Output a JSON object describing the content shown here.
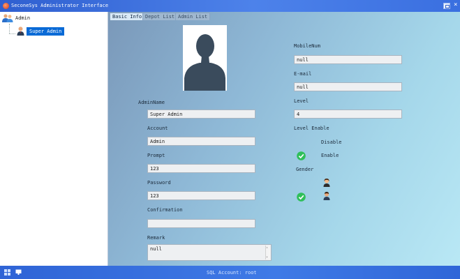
{
  "window": {
    "title": "SeconeSys Administrator Interface"
  },
  "tree": {
    "root_label": "Admin",
    "child_label": "Super Admin"
  },
  "tabs": [
    {
      "label": "Basic Info",
      "active": true
    },
    {
      "label": "Depot List",
      "active": false
    },
    {
      "label": "Admin List",
      "active": false
    }
  ],
  "form": {
    "admin_name": {
      "label": "AdminName",
      "value": "Super Admin"
    },
    "account": {
      "label": "Account",
      "value": "Admin"
    },
    "prompt": {
      "label": "Prompt",
      "value": "123"
    },
    "password": {
      "label": "Password",
      "value": "123"
    },
    "confirmation": {
      "label": "Confirmation",
      "value": ""
    },
    "remark": {
      "label": "Remark",
      "value": "null"
    },
    "mobile": {
      "label": "MobileNum",
      "value": "null"
    },
    "email": {
      "label": "E-mail",
      "value": "null"
    },
    "level": {
      "label": "Level",
      "value": "4"
    },
    "level_enable": {
      "label": "Level Enable",
      "options": [
        "Disable",
        "Enable"
      ],
      "selected": "Enable"
    },
    "gender": {
      "label": "Gender",
      "options": [
        "female",
        "male"
      ],
      "selected": "male"
    }
  },
  "status": {
    "account_text": "SQL Account: root"
  },
  "colors": {
    "titlebar": "#3a6fe0",
    "selection": "#0a6ad6",
    "check": "#2fbf5a"
  }
}
